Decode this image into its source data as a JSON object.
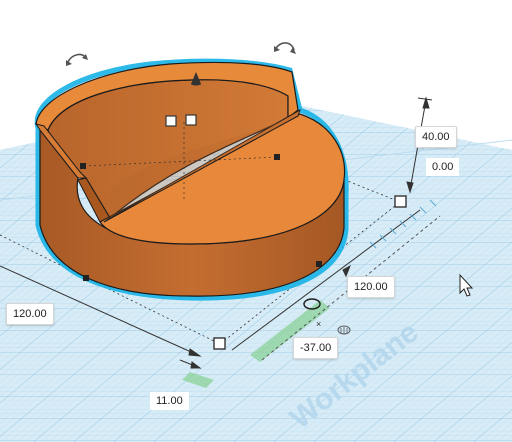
{
  "workplane": {
    "label": "Workplane"
  },
  "dimensions": {
    "height": "40.00",
    "elevation": "0.00",
    "length": "120.00",
    "width": "120.00",
    "x_offset": "11.00",
    "y_offset": "-37.00"
  },
  "colors": {
    "grid_background": "#cfe6f3",
    "grid_line": "#9ccbe6",
    "shape_front": "#b9652c",
    "shape_top": "#e8883a",
    "selection_outline": "#17b3e6"
  }
}
